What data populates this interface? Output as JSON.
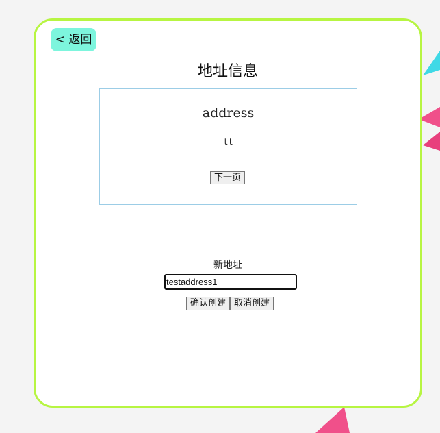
{
  "header": {
    "back_label": "< 返回",
    "title": "地址信息"
  },
  "address_card": {
    "heading": "address",
    "value": "tt",
    "next_page_label": "下一页"
  },
  "new_address": {
    "label": "新地址",
    "input_value": "testaddress1",
    "confirm_label": "确认创建",
    "cancel_label": "取消创建"
  },
  "colors": {
    "page_background": "#f4f4f4",
    "card_border": "#b7f542",
    "back_button_bg": "#7df5dd",
    "address_box_border": "#9ccde6",
    "decoration_cyan": "#3fd9e6",
    "decoration_pink": "#f0508a"
  }
}
